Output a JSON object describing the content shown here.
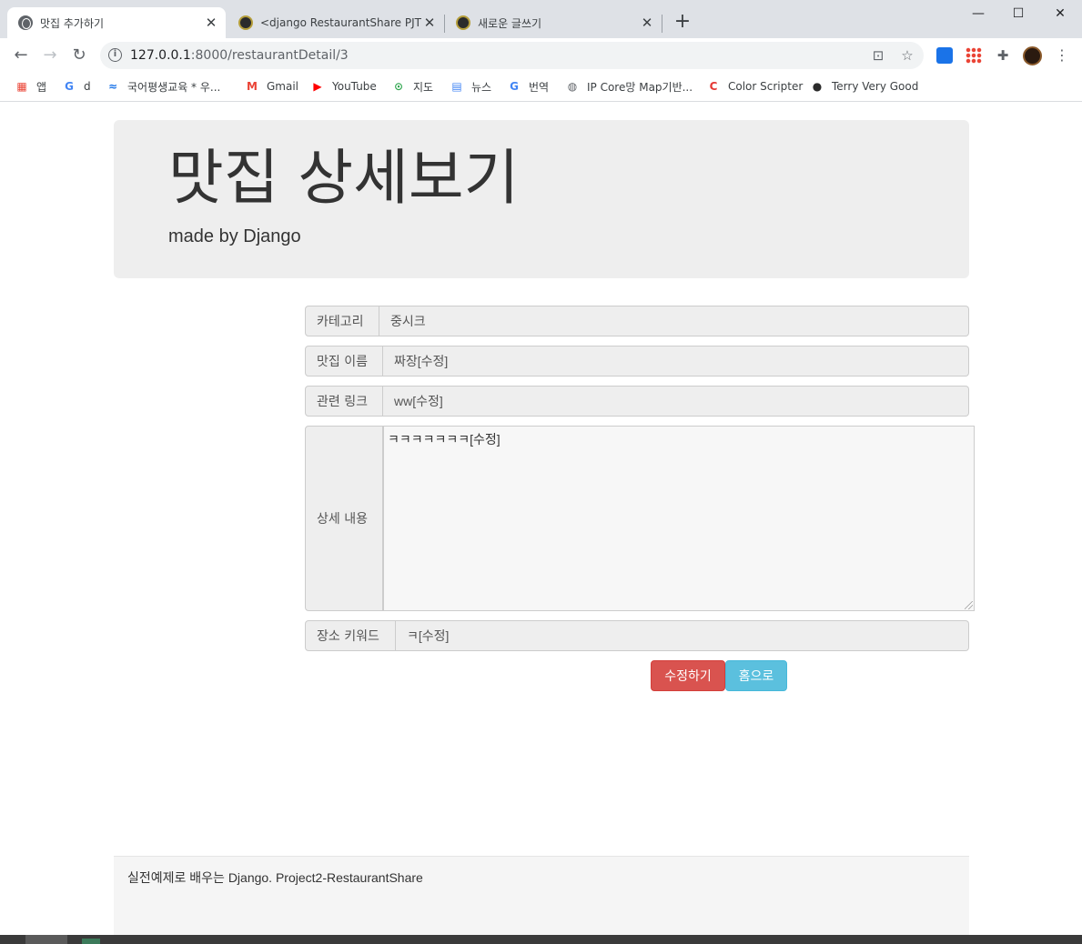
{
  "browser": {
    "tabs": [
      {
        "title": "맛집 추가하기",
        "favicon": "globe-icon",
        "active": true
      },
      {
        "title": "<django RestaurantShare PJT>",
        "favicon": "django-icon",
        "active": false
      },
      {
        "title": "새로운 글쓰기",
        "favicon": "django-icon",
        "active": false
      }
    ],
    "close_glyph": "✕",
    "new_tab_glyph": "+",
    "window": {
      "minimize": "—",
      "maximize": "☐",
      "close": "✕"
    },
    "nav": {
      "back": "←",
      "forward": "→",
      "reload": "↻"
    },
    "url_host": "127.0.0.1",
    "url_path": ":8000/restaurantDetail/3",
    "bookmarks": [
      {
        "label": "앱",
        "icon": "apps-icon",
        "color": "#ea4335"
      },
      {
        "label": "d",
        "icon": "google-icon",
        "color": "#4285f4"
      },
      {
        "label": "국어평생교육 * 우...",
        "icon": "bookmark-icon",
        "color": "#1a73e8"
      },
      {
        "label": "Gmail",
        "icon": "gmail-icon",
        "color": "#ea4335"
      },
      {
        "label": "YouTube",
        "icon": "youtube-icon",
        "color": "#ff0000"
      },
      {
        "label": "지도",
        "icon": "maps-icon",
        "color": "#34a853"
      },
      {
        "label": "뉴스",
        "icon": "news-icon",
        "color": "#4285f4"
      },
      {
        "label": "번역",
        "icon": "translate-icon",
        "color": "#4285f4"
      },
      {
        "label": "IP Core망 Map기반...",
        "icon": "globe-icon",
        "color": "#5f6368"
      },
      {
        "label": "Color Scripter",
        "icon": "colorscripter-icon",
        "color": "#e53935"
      },
      {
        "label": "Terry Very Good",
        "icon": "django-icon",
        "color": "#2b2b2b"
      }
    ]
  },
  "header": {
    "title": "맛집 상세보기",
    "subtitle": "made by Django"
  },
  "form": {
    "category": {
      "label": "카테고리",
      "value": "중시크"
    },
    "name": {
      "label": "맛집 이름",
      "value": "짜장[수정]"
    },
    "link": {
      "label": "관련 링크",
      "value": "ww[수정]"
    },
    "content": {
      "label": "상세 내용",
      "value": "ㅋㅋㅋㅋㅋㅋㅋ[수정]"
    },
    "keyword": {
      "label": "장소 키워드",
      "value": "ㅋ[수정]"
    }
  },
  "buttons": {
    "edit": "수정하기",
    "home": "홈으로"
  },
  "footer": {
    "text": "실전예제로 배우는 Django. Project2-RestaurantShare"
  },
  "colors": {
    "danger": "#d9534f",
    "info": "#5bc0de",
    "jumbotron": "#eeeeee"
  }
}
